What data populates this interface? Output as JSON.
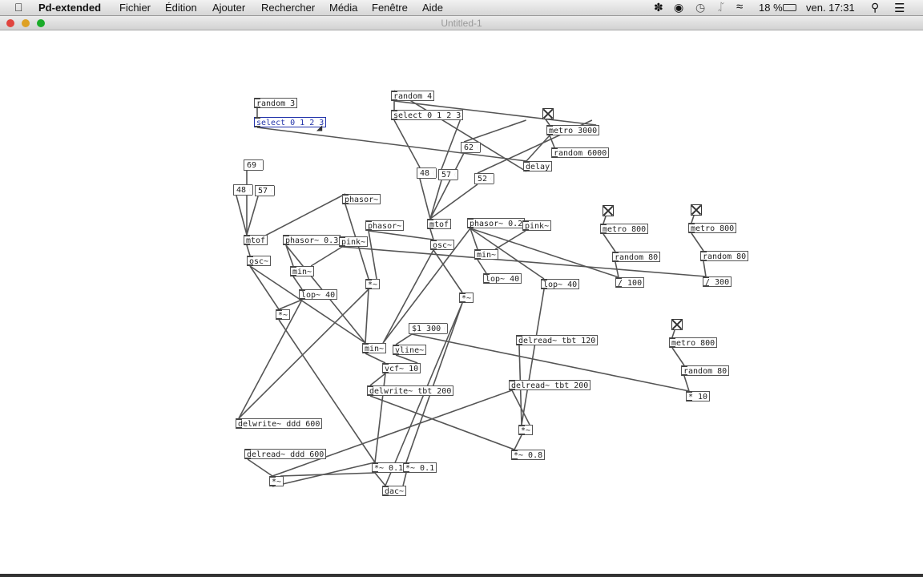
{
  "menubar": {
    "app_name": "Pd-extended",
    "items": [
      "Fichier",
      "Édition",
      "Ajouter",
      "Rechercher",
      "Média",
      "Fenêtre",
      "Aide"
    ],
    "battery": "18 %",
    "clock": "ven. 17:31"
  },
  "window": {
    "title": "Untitled-1",
    "traffic_light_colors": [
      "#e0443e",
      "#dea123",
      "#1aab29"
    ]
  },
  "patch": {
    "objects": [
      {
        "id": "rnd3",
        "text": "random 3"
      },
      {
        "id": "sel3",
        "text": "select 0 1 2 3"
      },
      {
        "id": "rnd4",
        "text": "random 4"
      },
      {
        "id": "sel4",
        "text": "select 0 1 2 3"
      },
      {
        "id": "metro3000",
        "text": "metro 3000"
      },
      {
        "id": "rnd6000",
        "text": "random 6000"
      },
      {
        "id": "delay",
        "text": "delay"
      },
      {
        "id": "mtof1",
        "text": "mtof"
      },
      {
        "id": "osc1",
        "text": "osc~"
      },
      {
        "id": "phasor1",
        "text": "phasor~"
      },
      {
        "id": "phasor2",
        "text": "phasor~"
      },
      {
        "id": "phasor03",
        "text": "phasor~ 0.3"
      },
      {
        "id": "pink1",
        "text": "pink~"
      },
      {
        "id": "mtof2",
        "text": "mtof"
      },
      {
        "id": "osc2",
        "text": "osc~"
      },
      {
        "id": "phasor02",
        "text": "phasor~ 0.2"
      },
      {
        "id": "pink2",
        "text": "pink~"
      },
      {
        "id": "min1",
        "text": "min~"
      },
      {
        "id": "min2",
        "text": "min~"
      },
      {
        "id": "lop40a",
        "text": "lop~ 40"
      },
      {
        "id": "lop40b",
        "text": "lop~ 40"
      },
      {
        "id": "lop40c",
        "text": "lop~ 40"
      },
      {
        "id": "mul1",
        "text": "*~"
      },
      {
        "id": "mul2",
        "text": "*~"
      },
      {
        "id": "mul3",
        "text": "*~"
      },
      {
        "id": "metro800a",
        "text": "metro 800"
      },
      {
        "id": "rnd80a",
        "text": "random 80"
      },
      {
        "id": "div100",
        "text": "/ 100"
      },
      {
        "id": "metro800b",
        "text": "metro 800"
      },
      {
        "id": "rnd80b",
        "text": "random 80"
      },
      {
        "id": "div300",
        "text": "/ 300"
      },
      {
        "id": "metro800c",
        "text": "metro 800"
      },
      {
        "id": "rnd80c",
        "text": "random 80"
      },
      {
        "id": "mul10",
        "text": "* 10"
      },
      {
        "id": "min3",
        "text": "min~"
      },
      {
        "id": "vline",
        "text": "vline~"
      },
      {
        "id": "vcf",
        "text": "vcf~ 10"
      },
      {
        "id": "delwrite_tbt",
        "text": "delwrite~ tbt 200"
      },
      {
        "id": "delread_tbt120",
        "text": "delread~ tbt 120"
      },
      {
        "id": "delread_tbt200",
        "text": "delread~ tbt 200"
      },
      {
        "id": "mul4",
        "text": "*~"
      },
      {
        "id": "mul08",
        "text": "*~ 0.8"
      },
      {
        "id": "delwrite_ddd",
        "text": "delwrite~ ddd 600"
      },
      {
        "id": "delread_ddd",
        "text": "delread~ ddd 600"
      },
      {
        "id": "mul5",
        "text": "*~"
      },
      {
        "id": "mul01a",
        "text": "*~ 0.1"
      },
      {
        "id": "mul01b",
        "text": "*~ 0.1"
      },
      {
        "id": "dac",
        "text": "dac~"
      }
    ],
    "messages": [
      {
        "id": "m62",
        "text": "62"
      },
      {
        "id": "m48b",
        "text": "48"
      },
      {
        "id": "m57b",
        "text": "57"
      },
      {
        "id": "m52",
        "text": "52"
      },
      {
        "id": "m69",
        "text": "69"
      },
      {
        "id": "m48a",
        "text": "48"
      },
      {
        "id": "m57a",
        "text": "57"
      },
      {
        "id": "m1300",
        "text": "$1 300"
      }
    ]
  }
}
